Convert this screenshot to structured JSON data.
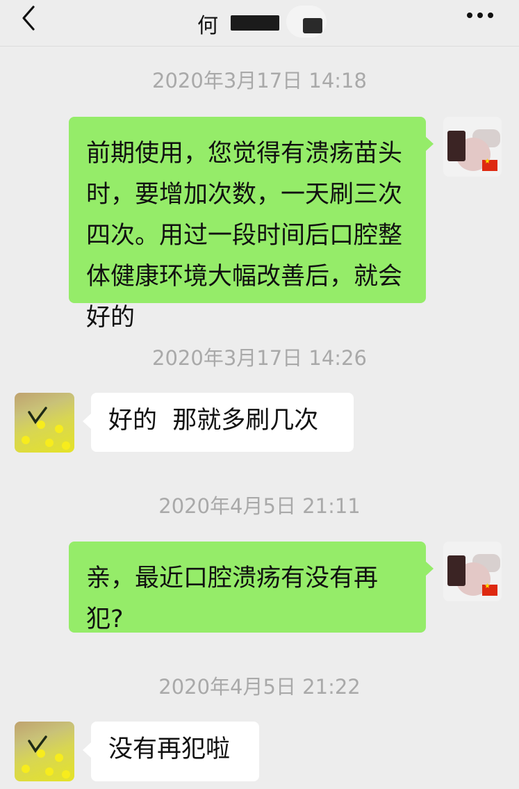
{
  "header": {
    "title_visible": "何",
    "back_icon": "chevron-left-icon",
    "more_icon": "more-dots-icon"
  },
  "colors": {
    "background": "#ededed",
    "sent_bubble": "#95ec69",
    "received_bubble": "#ffffff",
    "timestamp_text": "#a9a9a9"
  },
  "messages": [
    {
      "timestamp": "2020年3月17日 14:18",
      "sender": "self",
      "text": "前期使用，您觉得有溃疡苗头时，要增加次数，一天刷三次四次。用过一段时间后口腔整体健康环境大幅改善后，就会好的"
    },
    {
      "timestamp": "2020年3月17日 14:26",
      "sender": "other",
      "text": "好的  那就多刷几次"
    },
    {
      "timestamp": "2020年4月5日 21:11",
      "sender": "self",
      "text": "亲，最近口腔溃疡有没有再犯?"
    },
    {
      "timestamp": "2020年4月5日 21:22",
      "sender": "other",
      "text": "没有再犯啦"
    }
  ]
}
